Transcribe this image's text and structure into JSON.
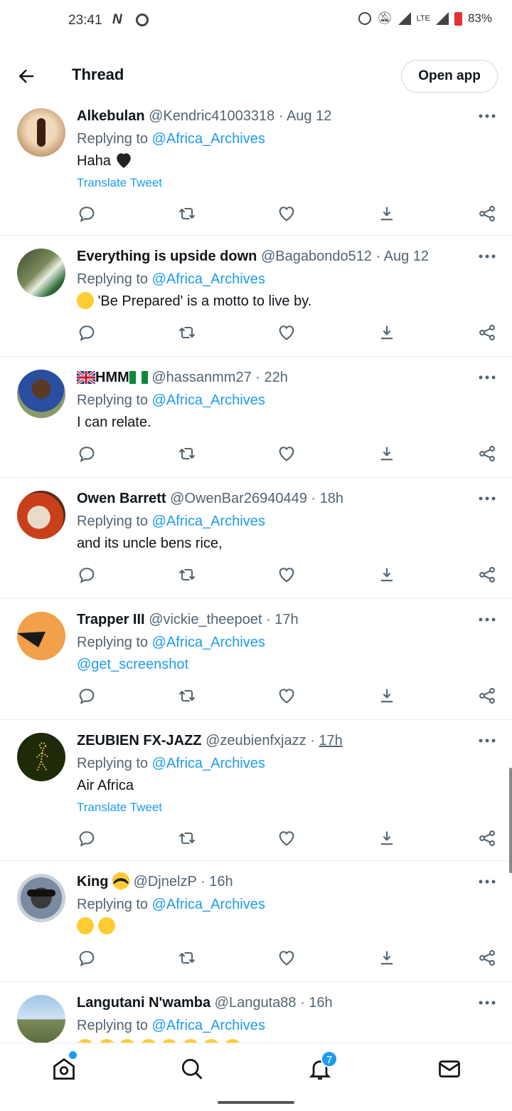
{
  "status_bar": {
    "time": "23:41",
    "n_icon": "N",
    "battery": "83%",
    "lte": "LTE"
  },
  "header": {
    "title": "Thread",
    "open_app": "Open app"
  },
  "tweets": [
    {
      "name": "Alkebulan",
      "handle": "@Kendric41003318",
      "dot": "·",
      "time": "Aug 12",
      "reply_prefix": "Replying to",
      "reply_to": "@Africa_Archives",
      "text": "Haha",
      "emoji": "black-heart",
      "translate": "Translate Tweet"
    },
    {
      "name": "Everything is upside down",
      "handle": "@Bagabondo512",
      "dot": "·",
      "time": "Aug 12",
      "reply_prefix": "Replying to",
      "reply_to": "@Africa_Archives",
      "text": "'Be Prepared' is a motto to live by.",
      "emoji": "grinning-face"
    },
    {
      "name": "HMM",
      "handle": "@hassanmm27",
      "dot": "·",
      "time": "22h",
      "reply_prefix": "Replying to",
      "reply_to": "@Africa_Archives",
      "text": "I can relate.",
      "flags": [
        "uk-flag",
        "nigeria-flag"
      ]
    },
    {
      "name": "Owen Barrett",
      "handle": "@OwenBar26940449",
      "dot": "·",
      "time": "18h",
      "reply_prefix": "Replying to",
      "reply_to": "@Africa_Archives",
      "text": "and its uncle bens rice,"
    },
    {
      "name": "Trapper III",
      "handle": "@vickie_theepoet",
      "dot": "·",
      "time": "17h",
      "reply_prefix": "Replying to",
      "reply_to": "@Africa_Archives",
      "text": "@get_screenshot"
    },
    {
      "name": "ZEUBIEN FX-JAZZ",
      "handle": "@zeubienfxjazz",
      "dot": "·",
      "time": "17h",
      "reply_prefix": "Replying to",
      "reply_to": "@Africa_Archives",
      "text": "Air Africa",
      "translate": "Translate Tweet"
    },
    {
      "name": "King",
      "handle": "@DjnelzP",
      "dot": "·",
      "time": "16h",
      "reply_prefix": "Replying to",
      "reply_to": "@Africa_Archives",
      "emoji": "sunglasses-face",
      "text_emojis": [
        "rolling-laughing-face",
        "tears-of-joy-face"
      ]
    },
    {
      "name": "Langutani N'wamba",
      "handle": "@Languta88",
      "dot": "·",
      "time": "16h",
      "reply_prefix": "Replying to",
      "reply_to": "@Africa_Archives"
    }
  ],
  "bottom_nav": {
    "notification_count": "7",
    "items": [
      "home-icon",
      "search-icon",
      "bell-icon",
      "mail-icon"
    ]
  },
  "colors": {
    "accent": "#1d9bf0",
    "text": "#0f1419",
    "muted": "#536471",
    "divider": "#e6ecf0"
  }
}
